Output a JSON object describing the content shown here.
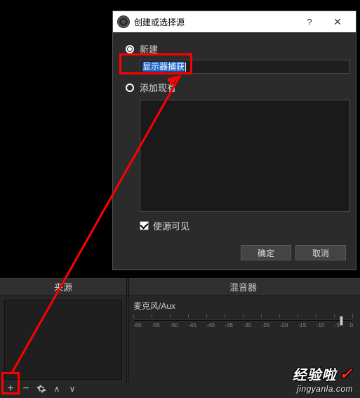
{
  "dialog": {
    "title": "创建或选择源",
    "help": "?",
    "close": "✕",
    "radio_new": "新建",
    "input_value": "显示器捕获",
    "radio_existing": "添加现有",
    "checkbox_visible": "使源可见",
    "ok": "确定",
    "cancel": "取消"
  },
  "panels": {
    "sources_title": "来源",
    "mixer_title": "混音器"
  },
  "mixer": {
    "track_label": "麦克风/Aux",
    "ticks": [
      "-60",
      "-55",
      "-50",
      "-45",
      "-40",
      "-35",
      "-30",
      "-25",
      "-20",
      "-15",
      "-10",
      "-5",
      "0"
    ]
  },
  "toolbar": {
    "add": "+",
    "remove": "−",
    "up": "∧",
    "down": "∨"
  },
  "watermark": {
    "text": "经验啦",
    "url": "jingyanla.com"
  }
}
